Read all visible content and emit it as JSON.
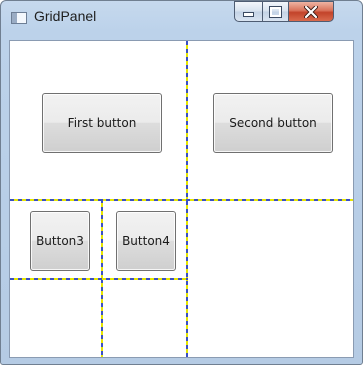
{
  "window": {
    "title": "GridPanel",
    "controls": {
      "minimize": "–",
      "maximize": "□",
      "close": "✕"
    }
  },
  "grid": {
    "buttons": [
      {
        "label": "First button"
      },
      {
        "label": "Second button"
      },
      {
        "label": "Button3"
      },
      {
        "label": "Button4"
      }
    ]
  },
  "colors": {
    "gridline_a": "#3a4fc4",
    "gridline_b": "#e6e600",
    "close": "#c2432a"
  }
}
